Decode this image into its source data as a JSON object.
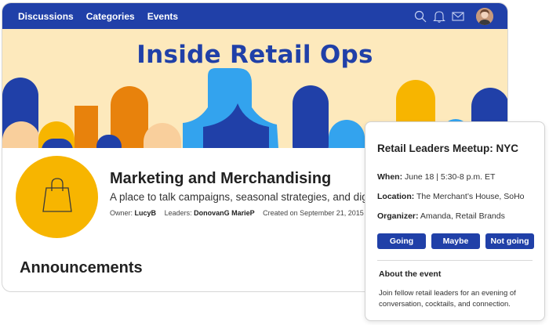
{
  "nav": {
    "links": [
      "Discussions",
      "Categories",
      "Events"
    ],
    "icons": [
      "search-icon",
      "bell-icon",
      "mail-icon"
    ],
    "avatar": "user-avatar"
  },
  "banner": {
    "title": "Inside Retail Ops"
  },
  "group": {
    "icon": "shopping-bag-icon",
    "title": "Marketing and Merchandising",
    "description": "A place to talk campaigns, seasonal strategies, and digital",
    "owner_label": "Owner:",
    "owner": "LucyB",
    "leaders_label": "Leaders:",
    "leaders": "DonovanG MarieP",
    "created": "Created on September 21, 2015"
  },
  "section": {
    "announcements": "Announcements"
  },
  "event_popup": {
    "title": "Retail Leaders Meetup: NYC",
    "when_label": "When:",
    "when": "June 18 | 5:30-8 p.m. ET",
    "location_label": "Location:",
    "location": "The Merchant’s House, SoHo",
    "organizer_label": "Organizer:",
    "organizer": "Amanda, Retail Brands",
    "buttons": {
      "going": "Going",
      "maybe": "Maybe",
      "not_going": "Not going"
    },
    "about_heading": "About the event",
    "about_text": "Join fellow retail leaders for an evening of conversation, cocktails, and connection."
  },
  "colors": {
    "brand_blue": "#2040a8",
    "banner_bg": "#fde9bc",
    "accent_yellow": "#f7b500",
    "accent_orange": "#e8820c",
    "light_blue": "#33a3ee",
    "peach": "#f9cf9c"
  }
}
